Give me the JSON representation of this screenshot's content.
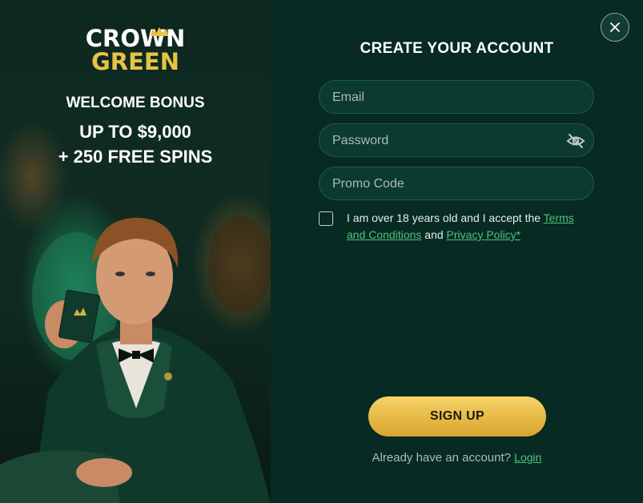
{
  "logo": {
    "line1": "CROWN",
    "line2": "GREEN"
  },
  "promo": {
    "welcome": "WELCOME BONUS",
    "amount": "UP TO $9,000",
    "spins": "+ 250 FREE SPINS"
  },
  "form": {
    "title": "CREATE YOUR ACCOUNT",
    "email_placeholder": "Email",
    "password_placeholder": "Password",
    "promo_placeholder": "Promo Code",
    "consent_prefix": "I am over 18 years old and I accept the ",
    "terms_link": "Terms and Conditions",
    "consent_and": " and ",
    "privacy_link": "Privacy Policy*",
    "signup_label": "SIGN UP",
    "login_prompt": "Already have an account?",
    "login_link": "Login"
  },
  "icons": {
    "close": "close-icon",
    "password_toggle": "eye-off-icon",
    "crown": "crown-icon"
  },
  "colors": {
    "panel_bg": "#072a22",
    "field_bg": "#0c3a30",
    "link": "#4fc27c",
    "button_gold": "#e6b945",
    "logo_gold": "#e9c243"
  }
}
